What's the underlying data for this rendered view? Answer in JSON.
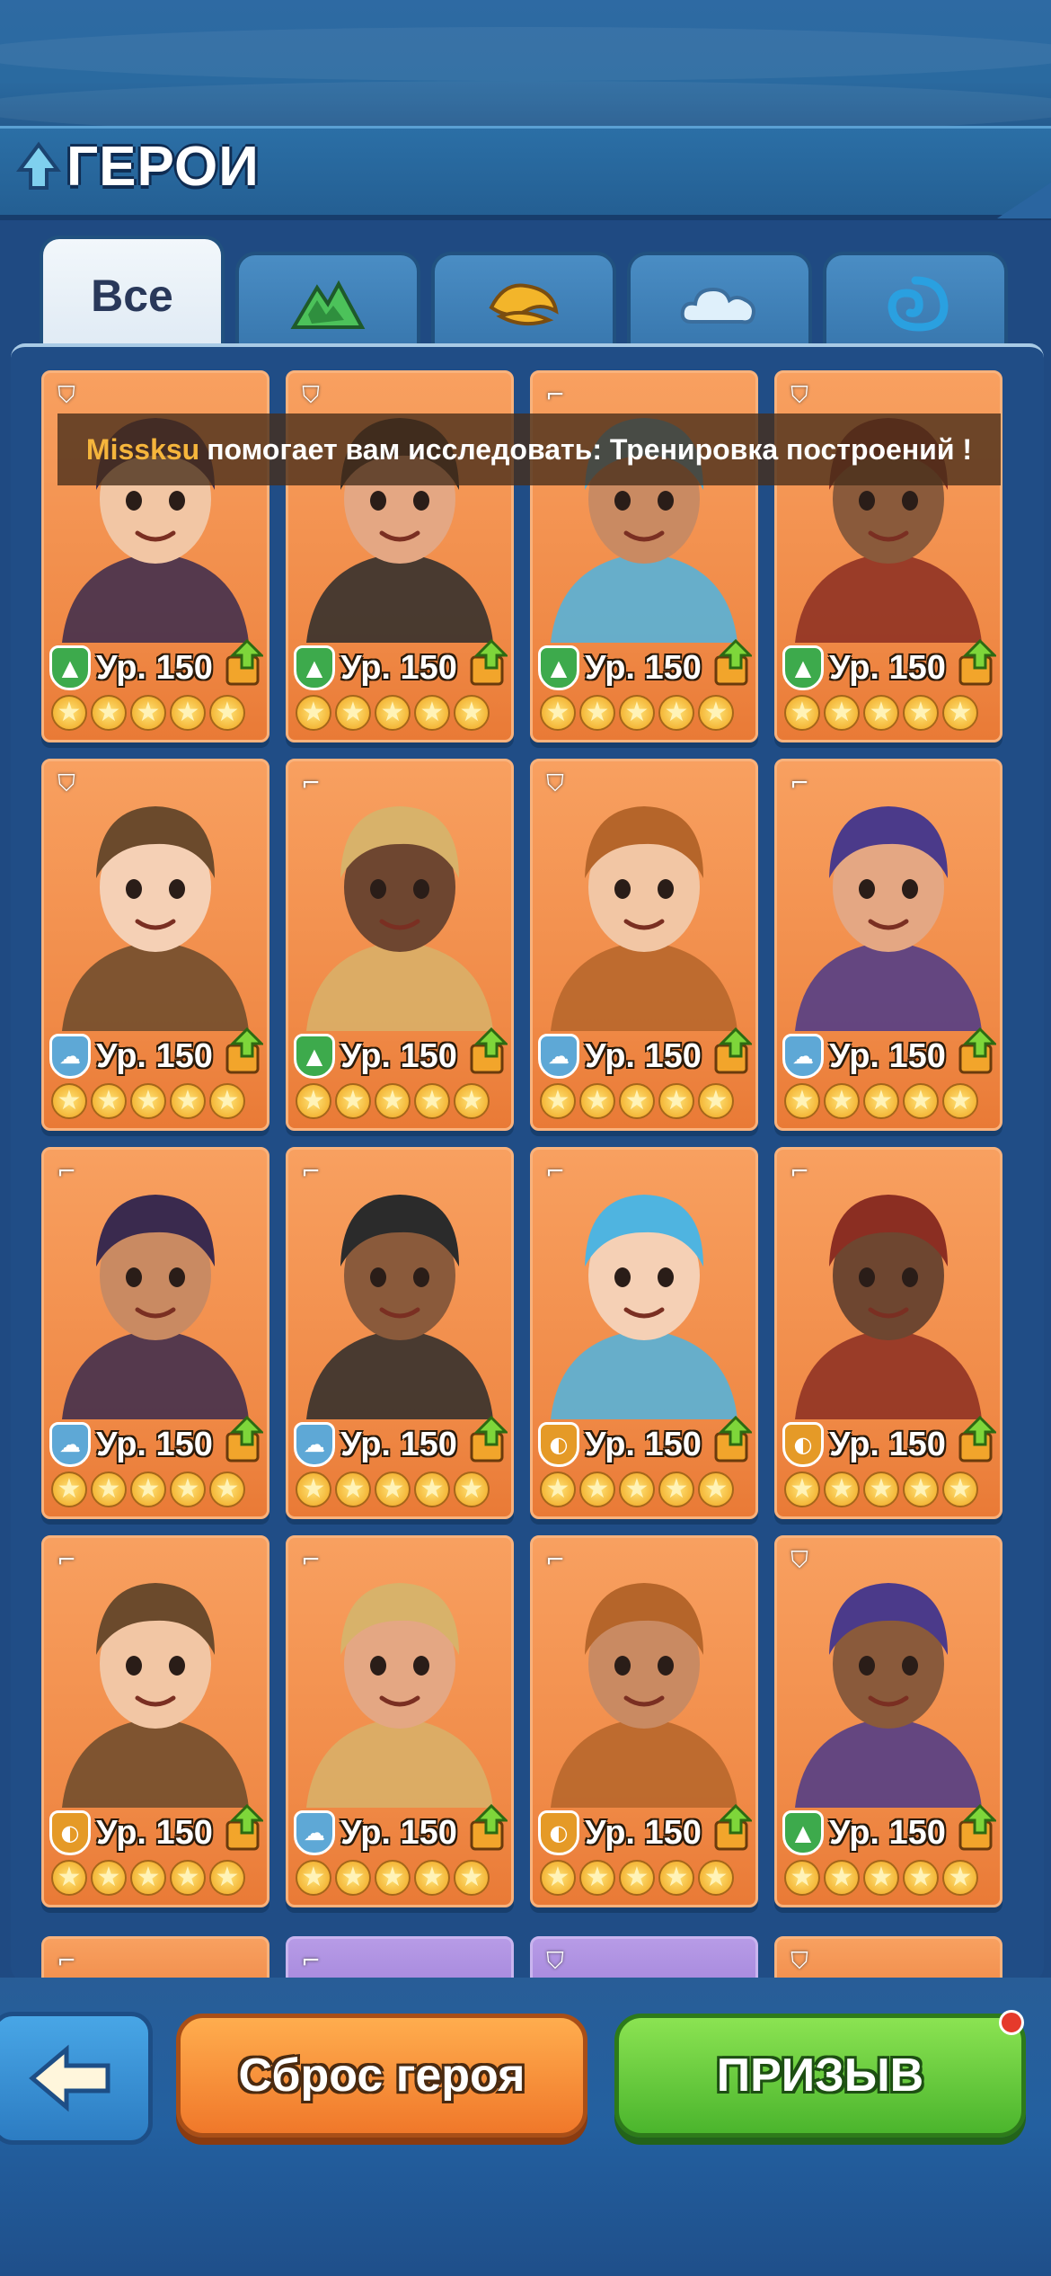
{
  "header": {
    "title": "ГЕРОИ"
  },
  "tabs": [
    {
      "label": "Все",
      "icon": "all",
      "active": true
    },
    {
      "label": "",
      "icon": "mountain-icon",
      "active": false
    },
    {
      "label": "",
      "icon": "desert-icon",
      "active": false
    },
    {
      "label": "",
      "icon": "cloud-icon",
      "active": false
    },
    {
      "label": "",
      "icon": "wave-icon",
      "active": false
    }
  ],
  "notice": {
    "user": "Missksu",
    "message": "помогает вам исследовать: Тренировка построений !"
  },
  "heroes": [
    {
      "level": "Ур. 150",
      "faction": "green",
      "class": "shield",
      "stars": 5
    },
    {
      "level": "Ур. 150",
      "faction": "green",
      "class": "shield",
      "stars": 5
    },
    {
      "level": "Ур. 150",
      "faction": "green",
      "class": "gun",
      "stars": 5
    },
    {
      "level": "Ур. 150",
      "faction": "green",
      "class": "shield",
      "stars": 5
    },
    {
      "level": "Ур. 150",
      "faction": "blue",
      "class": "shield",
      "stars": 5
    },
    {
      "level": "Ур. 150",
      "faction": "green",
      "class": "gun",
      "stars": 5
    },
    {
      "level": "Ур. 150",
      "faction": "blue",
      "class": "shield",
      "stars": 5
    },
    {
      "level": "Ур. 150",
      "faction": "blue",
      "class": "gun",
      "stars": 5
    },
    {
      "level": "Ур. 150",
      "faction": "blue",
      "class": "gun",
      "stars": 5
    },
    {
      "level": "Ур. 150",
      "faction": "blue",
      "class": "gun",
      "stars": 5
    },
    {
      "level": "Ур. 150",
      "faction": "orange",
      "class": "gun",
      "stars": 5
    },
    {
      "level": "Ур. 150",
      "faction": "orange",
      "class": "gun",
      "stars": 5
    },
    {
      "level": "Ур. 150",
      "faction": "orange",
      "class": "gun",
      "stars": 5
    },
    {
      "level": "Ур. 150",
      "faction": "blue",
      "class": "gun",
      "stars": 5
    },
    {
      "level": "Ур. 150",
      "faction": "orange",
      "class": "gun",
      "stars": 5
    },
    {
      "level": "Ур. 150",
      "faction": "green",
      "class": "shield",
      "stars": 5
    }
  ],
  "partial_row": [
    {
      "class": "gun",
      "tint": "orange"
    },
    {
      "class": "gun",
      "tint": "purple"
    },
    {
      "class": "shield",
      "tint": "purple"
    },
    {
      "class": "shield",
      "tint": "orange"
    }
  ],
  "buttons": {
    "back": "back-arrow-icon",
    "reset_label": "Сброс героя",
    "summon_label": "ПРИЗЫВ"
  },
  "colors": {
    "background": "#1f4a82",
    "card_orange": "#f08a47",
    "summon_green": "#4bb52d",
    "reset_orange": "#f0782a",
    "notification_dot": "#e53a2b"
  }
}
